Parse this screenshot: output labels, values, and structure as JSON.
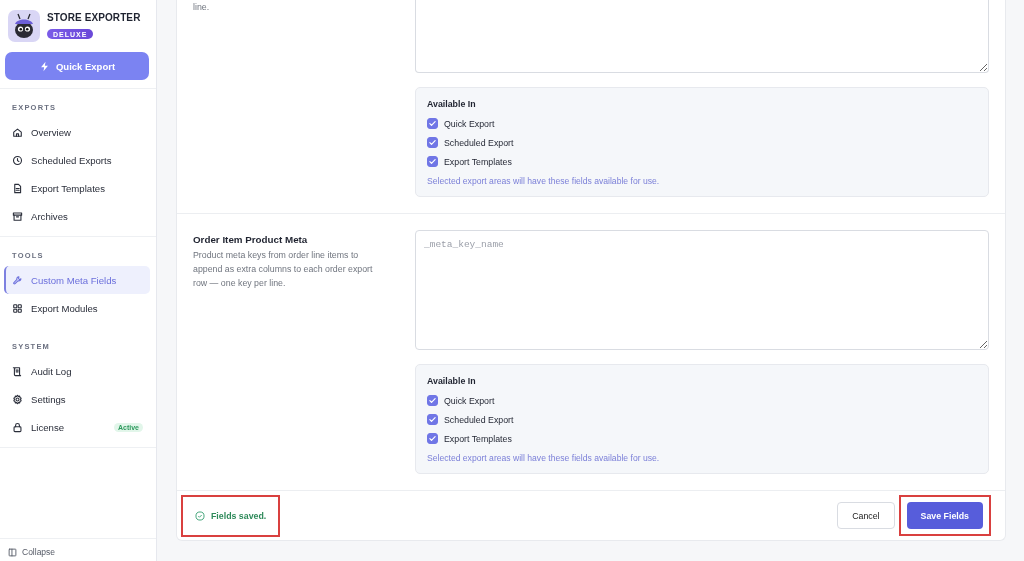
{
  "sidebar": {
    "brand": {
      "title": "STORE EXPORTER",
      "badge": "DELUXE"
    },
    "quick_export": "Quick Export",
    "groups": [
      {
        "label": "EXPORTS",
        "items": [
          {
            "label": "Overview",
            "selected": false
          },
          {
            "label": "Scheduled Exports",
            "selected": false
          },
          {
            "label": "Export Templates",
            "selected": false
          },
          {
            "label": "Archives",
            "selected": false
          }
        ]
      },
      {
        "label": "TOOLS",
        "items": [
          {
            "label": "Custom Meta Fields",
            "selected": true
          },
          {
            "label": "Export Modules",
            "selected": false
          }
        ]
      },
      {
        "label": "SYSTEM",
        "items": [
          {
            "label": "Audit Log",
            "selected": false
          },
          {
            "label": "Settings",
            "selected": false
          },
          {
            "label": "License",
            "selected": false,
            "badge": "Active"
          }
        ]
      }
    ],
    "collapse": "Collapse"
  },
  "sections": [
    {
      "description": "line.",
      "available": {
        "title": "Available In",
        "options": [
          {
            "label": "Quick Export",
            "checked": true
          },
          {
            "label": "Scheduled Export",
            "checked": true
          },
          {
            "label": "Export Templates",
            "checked": true
          }
        ],
        "hint": "Selected export areas will have these fields available for use."
      }
    },
    {
      "title": "Order Item Product Meta",
      "description": "Product meta keys from order line items to append as extra columns to each order export row — one key per line.",
      "textarea": {
        "placeholder": "_meta_key_name"
      },
      "available": {
        "title": "Available In",
        "options": [
          {
            "label": "Quick Export",
            "checked": true
          },
          {
            "label": "Scheduled Export",
            "checked": true
          },
          {
            "label": "Export Templates",
            "checked": true
          }
        ],
        "hint": "Selected export areas will have these fields available for use."
      }
    }
  ],
  "footer": {
    "status": {
      "text": "Fields saved.",
      "highlighted": true
    },
    "cancel": "Cancel",
    "save": {
      "label": "Save Fields",
      "highlighted": true
    }
  }
}
